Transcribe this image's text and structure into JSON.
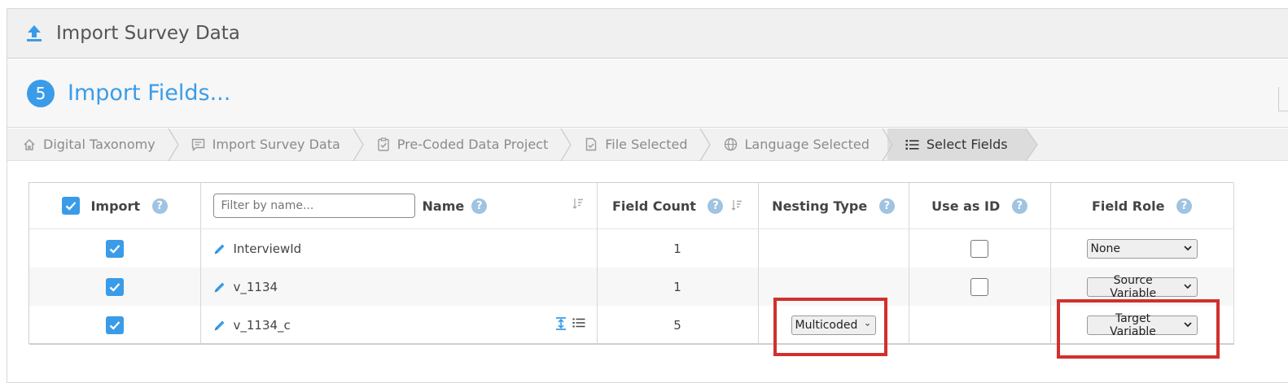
{
  "header": {
    "title": "Import Survey Data",
    "icon": "upload-icon"
  },
  "step": {
    "number": "5",
    "title": "Import Fields..."
  },
  "breadcrumb": [
    {
      "label": "Digital Taxonomy",
      "icon": "home-icon"
    },
    {
      "label": "Import Survey Data",
      "icon": "message-icon"
    },
    {
      "label": "Pre-Coded Data Project",
      "icon": "clipboard-check-icon"
    },
    {
      "label": "File Selected",
      "icon": "file-check-icon"
    },
    {
      "label": "Language Selected",
      "icon": "globe-icon"
    },
    {
      "label": "Select Fields",
      "icon": "list-icon"
    }
  ],
  "table": {
    "headers": {
      "import": "Import",
      "name": "Name",
      "filter_placeholder": "Filter by name...",
      "field_count": "Field Count",
      "nesting_type": "Nesting Type",
      "use_as_id": "Use as ID",
      "field_role": "Field Role",
      "help": "?"
    },
    "rows": [
      {
        "import": true,
        "name": "InterviewId",
        "field_count": "1",
        "nesting_type": "",
        "use_as_id": false,
        "field_role": "None"
      },
      {
        "import": true,
        "name": "v_1134",
        "field_count": "1",
        "nesting_type": "",
        "use_as_id": false,
        "field_role": "Source Variable"
      },
      {
        "import": true,
        "name": "v_1134_c",
        "field_count": "5",
        "nesting_type": "Multicoded",
        "use_as_id": null,
        "field_role": "Target Variable"
      }
    ]
  },
  "colors": {
    "accent": "#3a9ce8",
    "highlight": "#d0302e",
    "help": "#9fc3e1"
  }
}
